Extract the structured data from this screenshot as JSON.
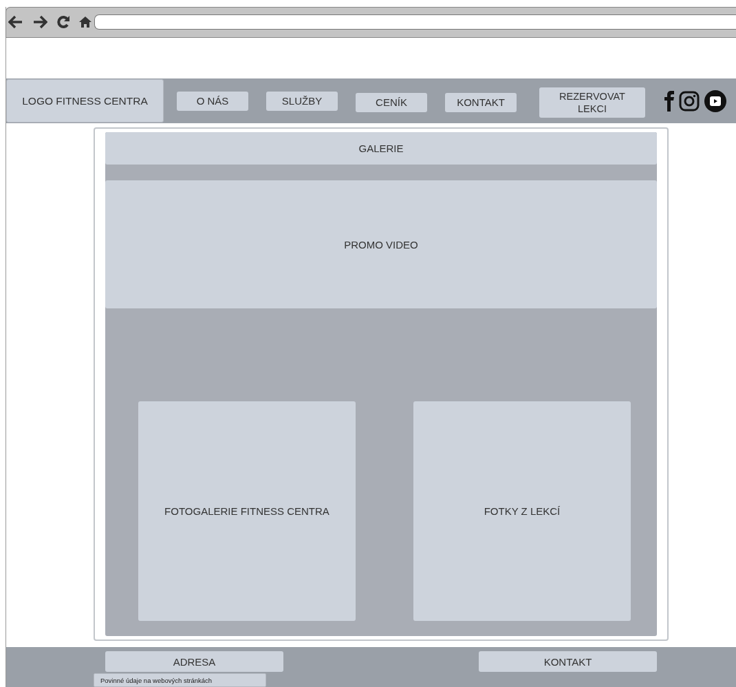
{
  "header": {
    "logo": "LOGO FITNESS CENTRA",
    "nav": [
      "O NÁS",
      "SLUŽBY",
      "CENÍK",
      "KONTAKT"
    ],
    "cta": "REZERVOVAT LEKCI"
  },
  "main": {
    "title": "GALERIE",
    "promo": "PROMO VIDEO",
    "galleries": [
      "FOTOGALERIE FITNESS CENTRA",
      "FOTKY Z LEKCÍ"
    ]
  },
  "footer": {
    "links": [
      "ADRESA",
      "KONTAKT"
    ],
    "note": "Povinné údaje na webových stránkách"
  }
}
